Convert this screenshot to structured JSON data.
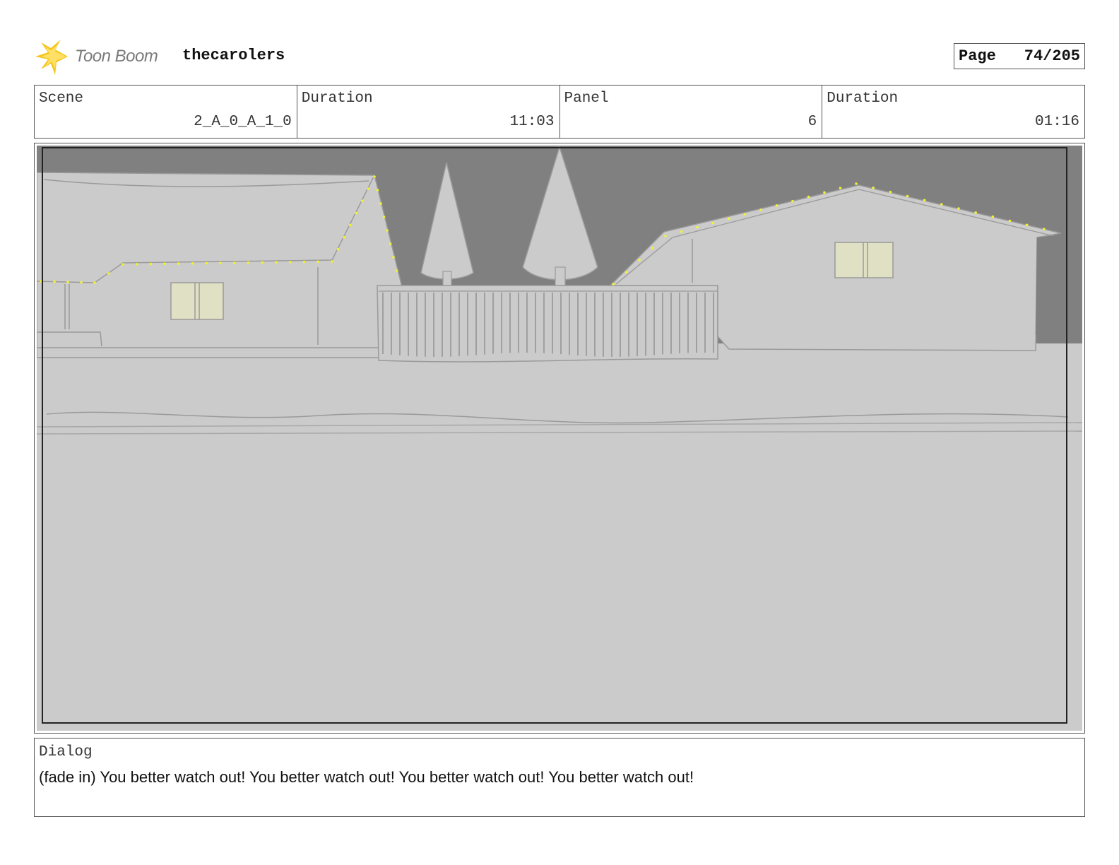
{
  "header": {
    "logo_text": "Toon Boom",
    "project_title": "thecarolers",
    "page_label": "Page",
    "page_value": "74/205"
  },
  "info": {
    "scene_label": "Scene",
    "scene_value": "2_A_0_A_1_0",
    "scene_duration_label": "Duration",
    "scene_duration_value": "11:03",
    "panel_label": "Panel",
    "panel_value": "6",
    "panel_duration_label": "Duration",
    "panel_duration_value": "01:16"
  },
  "dialog": {
    "label": "Dialog",
    "text": "(fade in) You better watch out! You better watch out! You better watch out! You better watch out!"
  },
  "colors": {
    "sky": "#808080",
    "ground": "#cbcbcb",
    "lights": "#f2f230",
    "window": "#e0e0c4",
    "logo_star": "#f5c518"
  },
  "icons": {
    "logo": "starburst-logo-icon"
  }
}
